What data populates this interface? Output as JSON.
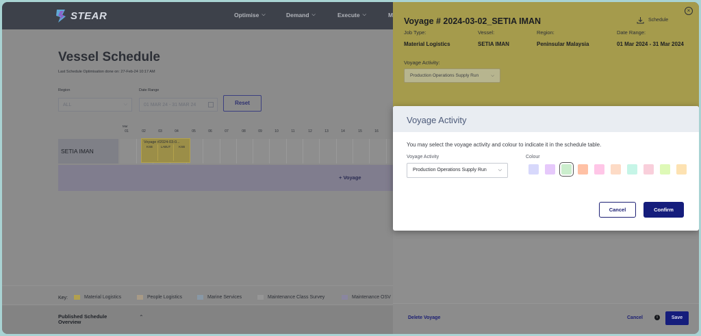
{
  "app": {
    "logo_text": "STEAR"
  },
  "nav": [
    {
      "label": "Optimise"
    },
    {
      "label": "Demand"
    },
    {
      "label": "Execute"
    },
    {
      "label": "M"
    }
  ],
  "page": {
    "title": "Vessel Schedule",
    "subtitle": "Last Schedule Optimisation done on: 27-Feb-24 10:17 AM",
    "region_label": "Region",
    "region_value": "ALL",
    "date_range_label": "Date Range",
    "date_range_value": "01 MAR 24 - 31 MAR 24",
    "reset_label": "Reset"
  },
  "schedule": {
    "month_label": "Mar",
    "days": [
      "01",
      "02",
      "03",
      "04",
      "05",
      "06",
      "07",
      "08",
      "09",
      "10",
      "11",
      "12",
      "13",
      "14",
      "15",
      "16"
    ],
    "vessel": "SETIA IMAN",
    "voyage_label": "Voyage #2024-03-0...",
    "voyage_cells": [
      "KSB",
      "LABUT",
      "KSB"
    ],
    "add_voyage_label": "+ Voyage"
  },
  "key": {
    "title": "Key:",
    "items": [
      {
        "label": "Material Logistics",
        "color": "#b2a04e"
      },
      {
        "label": "People Logistics",
        "color": "#a89a86"
      },
      {
        "label": "Marine Services",
        "color": "#8898a6"
      },
      {
        "label": "Maintenance Class Survey",
        "color": "#969696"
      },
      {
        "label": "Maintenance OSV",
        "color": "#8a86a0"
      }
    ]
  },
  "published": {
    "title": "Published Schedule Overview"
  },
  "panel": {
    "title": "Voyage # 2024-03-02_SETIA IMAN",
    "schedule_label": "Schedule",
    "fields": [
      {
        "label": "Job Type:",
        "value": "Material Logistics"
      },
      {
        "label": "Vessel:",
        "value": "SETIA IMAN"
      },
      {
        "label": "Region:",
        "value": "Peninsular Malaysia"
      },
      {
        "label": "Date Range:",
        "value": "01 Mar 2024 - 31 Mar 2024"
      }
    ],
    "activity_label": "Voyage Activity:",
    "activity_value": "Production Operations Supply Run",
    "delete_label": "Delete Voyage",
    "cancel_label": "Cancel",
    "save_label": "Save"
  },
  "modal": {
    "title": "Voyage Activity",
    "description": "You may select the voyage activity and colour to indicate it in the schedule table.",
    "activity_label": "Voyage Activity",
    "activity_value": "Production Operations Supply Run",
    "colour_label": "Colour",
    "colours": [
      "#d7d8fb",
      "#e6c9fb",
      "#cbeecd",
      "#ffc1a5",
      "#ffc6e7",
      "#fddbc6",
      "#c6f5e7",
      "#f9cfdb",
      "#def9b7",
      "#fde2b2"
    ],
    "selected_colour_index": 2,
    "cancel_label": "Cancel",
    "confirm_label": "Confirm"
  }
}
